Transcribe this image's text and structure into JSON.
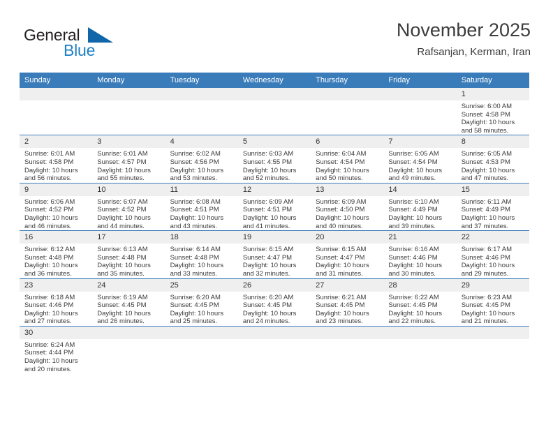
{
  "brand": {
    "name_top": "General",
    "name_bottom": "Blue",
    "flag_icon": "blue-triangle-flag-icon",
    "color_dark": "#231f20",
    "color_blue": "#1f7fc4"
  },
  "header": {
    "title": "November 2025",
    "subtitle": "Rafsanjan, Kerman, Iran"
  },
  "theme": {
    "header_blue": "#3a7cba",
    "daynum_band": "#efefef",
    "text": "#3a3a3a"
  },
  "calendar": {
    "weekday_headers": [
      "Sunday",
      "Monday",
      "Tuesday",
      "Wednesday",
      "Thursday",
      "Friday",
      "Saturday"
    ],
    "weeks": [
      [
        {
          "day": "",
          "lines": []
        },
        {
          "day": "",
          "lines": []
        },
        {
          "day": "",
          "lines": []
        },
        {
          "day": "",
          "lines": []
        },
        {
          "day": "",
          "lines": []
        },
        {
          "day": "",
          "lines": []
        },
        {
          "day": "1",
          "lines": [
            "Sunrise: 6:00 AM",
            "Sunset: 4:58 PM",
            "Daylight: 10 hours",
            "and 58 minutes."
          ]
        }
      ],
      [
        {
          "day": "2",
          "lines": [
            "Sunrise: 6:01 AM",
            "Sunset: 4:58 PM",
            "Daylight: 10 hours",
            "and 56 minutes."
          ]
        },
        {
          "day": "3",
          "lines": [
            "Sunrise: 6:01 AM",
            "Sunset: 4:57 PM",
            "Daylight: 10 hours",
            "and 55 minutes."
          ]
        },
        {
          "day": "4",
          "lines": [
            "Sunrise: 6:02 AM",
            "Sunset: 4:56 PM",
            "Daylight: 10 hours",
            "and 53 minutes."
          ]
        },
        {
          "day": "5",
          "lines": [
            "Sunrise: 6:03 AM",
            "Sunset: 4:55 PM",
            "Daylight: 10 hours",
            "and 52 minutes."
          ]
        },
        {
          "day": "6",
          "lines": [
            "Sunrise: 6:04 AM",
            "Sunset: 4:54 PM",
            "Daylight: 10 hours",
            "and 50 minutes."
          ]
        },
        {
          "day": "7",
          "lines": [
            "Sunrise: 6:05 AM",
            "Sunset: 4:54 PM",
            "Daylight: 10 hours",
            "and 49 minutes."
          ]
        },
        {
          "day": "8",
          "lines": [
            "Sunrise: 6:05 AM",
            "Sunset: 4:53 PM",
            "Daylight: 10 hours",
            "and 47 minutes."
          ]
        }
      ],
      [
        {
          "day": "9",
          "lines": [
            "Sunrise: 6:06 AM",
            "Sunset: 4:52 PM",
            "Daylight: 10 hours",
            "and 46 minutes."
          ]
        },
        {
          "day": "10",
          "lines": [
            "Sunrise: 6:07 AM",
            "Sunset: 4:52 PM",
            "Daylight: 10 hours",
            "and 44 minutes."
          ]
        },
        {
          "day": "11",
          "lines": [
            "Sunrise: 6:08 AM",
            "Sunset: 4:51 PM",
            "Daylight: 10 hours",
            "and 43 minutes."
          ]
        },
        {
          "day": "12",
          "lines": [
            "Sunrise: 6:09 AM",
            "Sunset: 4:51 PM",
            "Daylight: 10 hours",
            "and 41 minutes."
          ]
        },
        {
          "day": "13",
          "lines": [
            "Sunrise: 6:09 AM",
            "Sunset: 4:50 PM",
            "Daylight: 10 hours",
            "and 40 minutes."
          ]
        },
        {
          "day": "14",
          "lines": [
            "Sunrise: 6:10 AM",
            "Sunset: 4:49 PM",
            "Daylight: 10 hours",
            "and 39 minutes."
          ]
        },
        {
          "day": "15",
          "lines": [
            "Sunrise: 6:11 AM",
            "Sunset: 4:49 PM",
            "Daylight: 10 hours",
            "and 37 minutes."
          ]
        }
      ],
      [
        {
          "day": "16",
          "lines": [
            "Sunrise: 6:12 AM",
            "Sunset: 4:48 PM",
            "Daylight: 10 hours",
            "and 36 minutes."
          ]
        },
        {
          "day": "17",
          "lines": [
            "Sunrise: 6:13 AM",
            "Sunset: 4:48 PM",
            "Daylight: 10 hours",
            "and 35 minutes."
          ]
        },
        {
          "day": "18",
          "lines": [
            "Sunrise: 6:14 AM",
            "Sunset: 4:48 PM",
            "Daylight: 10 hours",
            "and 33 minutes."
          ]
        },
        {
          "day": "19",
          "lines": [
            "Sunrise: 6:15 AM",
            "Sunset: 4:47 PM",
            "Daylight: 10 hours",
            "and 32 minutes."
          ]
        },
        {
          "day": "20",
          "lines": [
            "Sunrise: 6:15 AM",
            "Sunset: 4:47 PM",
            "Daylight: 10 hours",
            "and 31 minutes."
          ]
        },
        {
          "day": "21",
          "lines": [
            "Sunrise: 6:16 AM",
            "Sunset: 4:46 PM",
            "Daylight: 10 hours",
            "and 30 minutes."
          ]
        },
        {
          "day": "22",
          "lines": [
            "Sunrise: 6:17 AM",
            "Sunset: 4:46 PM",
            "Daylight: 10 hours",
            "and 29 minutes."
          ]
        }
      ],
      [
        {
          "day": "23",
          "lines": [
            "Sunrise: 6:18 AM",
            "Sunset: 4:46 PM",
            "Daylight: 10 hours",
            "and 27 minutes."
          ]
        },
        {
          "day": "24",
          "lines": [
            "Sunrise: 6:19 AM",
            "Sunset: 4:45 PM",
            "Daylight: 10 hours",
            "and 26 minutes."
          ]
        },
        {
          "day": "25",
          "lines": [
            "Sunrise: 6:20 AM",
            "Sunset: 4:45 PM",
            "Daylight: 10 hours",
            "and 25 minutes."
          ]
        },
        {
          "day": "26",
          "lines": [
            "Sunrise: 6:20 AM",
            "Sunset: 4:45 PM",
            "Daylight: 10 hours",
            "and 24 minutes."
          ]
        },
        {
          "day": "27",
          "lines": [
            "Sunrise: 6:21 AM",
            "Sunset: 4:45 PM",
            "Daylight: 10 hours",
            "and 23 minutes."
          ]
        },
        {
          "day": "28",
          "lines": [
            "Sunrise: 6:22 AM",
            "Sunset: 4:45 PM",
            "Daylight: 10 hours",
            "and 22 minutes."
          ]
        },
        {
          "day": "29",
          "lines": [
            "Sunrise: 6:23 AM",
            "Sunset: 4:45 PM",
            "Daylight: 10 hours",
            "and 21 minutes."
          ]
        }
      ],
      [
        {
          "day": "30",
          "lines": [
            "Sunrise: 6:24 AM",
            "Sunset: 4:44 PM",
            "Daylight: 10 hours",
            "and 20 minutes."
          ]
        },
        {
          "day": "",
          "lines": []
        },
        {
          "day": "",
          "lines": []
        },
        {
          "day": "",
          "lines": []
        },
        {
          "day": "",
          "lines": []
        },
        {
          "day": "",
          "lines": []
        },
        {
          "day": "",
          "lines": []
        }
      ]
    ]
  }
}
